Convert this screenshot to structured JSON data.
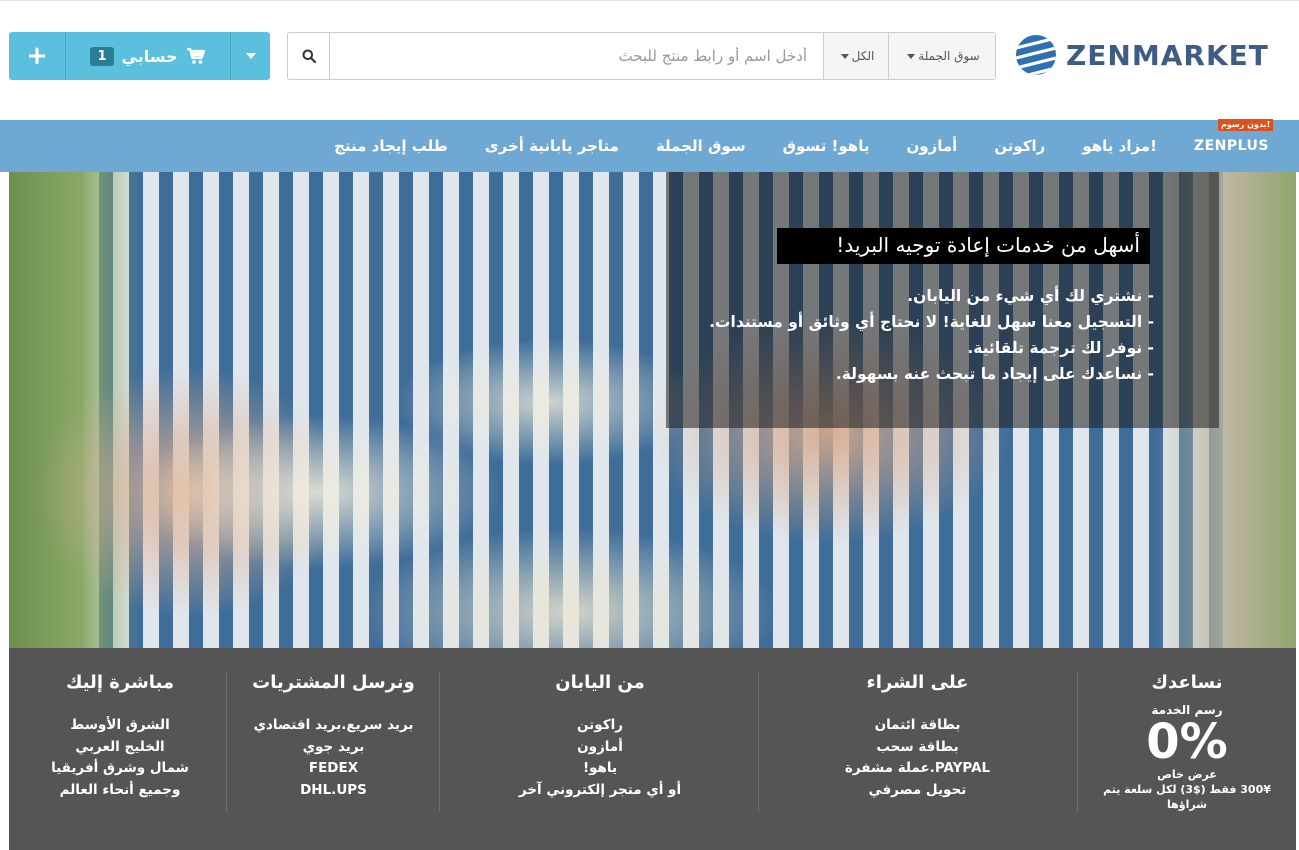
{
  "brand": {
    "name": "ZENMARKET",
    "accent": "#5bc0de",
    "nav_color": "#6fa8d3"
  },
  "search": {
    "store_select": "سوق الجملة",
    "category_select": "الكل",
    "placeholder": "أدخل اسم أو رابط منتج للبحث",
    "value": ""
  },
  "cart": {
    "label": "حسابي",
    "count": "1",
    "plus": "+"
  },
  "nav": {
    "badge": "بدون رسوم!",
    "items": [
      {
        "label": "ZENPLUS"
      },
      {
        "label": "مزاد ياهو!"
      },
      {
        "label": "راكوتن"
      },
      {
        "label": "أمازون"
      },
      {
        "label": "ياهو! تسوق"
      },
      {
        "label": "سوق الجملة"
      },
      {
        "label": "متاجر يابانية أخرى"
      },
      {
        "label": "طلب إيجاد منتج"
      }
    ]
  },
  "hero": {
    "title": "أسهل من خدمات إعادة توجيه البريد!",
    "bullets": [
      "- نشتري لك أي شيء من اليابان.",
      "- التسجيل معنا سهل للغاية! لا نحتاج أي وثائق أو مستندات.",
      "- نوفر لك ترجمة تلقائية.",
      "- نساعدك على إيجاد ما تبحث عنه بسهولة."
    ]
  },
  "footer": {
    "col1": {
      "heading": "نساعدك",
      "fee_label": "رسم الخدمة",
      "fee_value": "0%",
      "offer_label": "عرض خاص",
      "offer_text": "300¥ فقط ($3) لكل سلعة يتم شراؤها"
    },
    "col2": {
      "heading": "على الشراء",
      "items": [
        "بطاقة ائتمان",
        "بطاقة سحب",
        "PAYPAL.عملة مشفرة",
        "تحويل مصرفي"
      ]
    },
    "col3": {
      "heading": "من اليابان",
      "items": [
        "راكوتن",
        "أمازون",
        "ياهو!",
        "أو أي متجر إلكتروني آخر"
      ]
    },
    "col4": {
      "heading": "ونرسل المشتريات",
      "items": [
        "بريد سريع.بريد اقتصادي",
        "بريد جوي",
        "FEDEX",
        "DHL.UPS"
      ]
    },
    "col5": {
      "heading": "مباشرة إليك",
      "items": [
        "الشرق الأوسط",
        "الخليج العربي",
        "شمال وشرق أفريقيا",
        "وجميع أنحاء العالم"
      ]
    }
  }
}
